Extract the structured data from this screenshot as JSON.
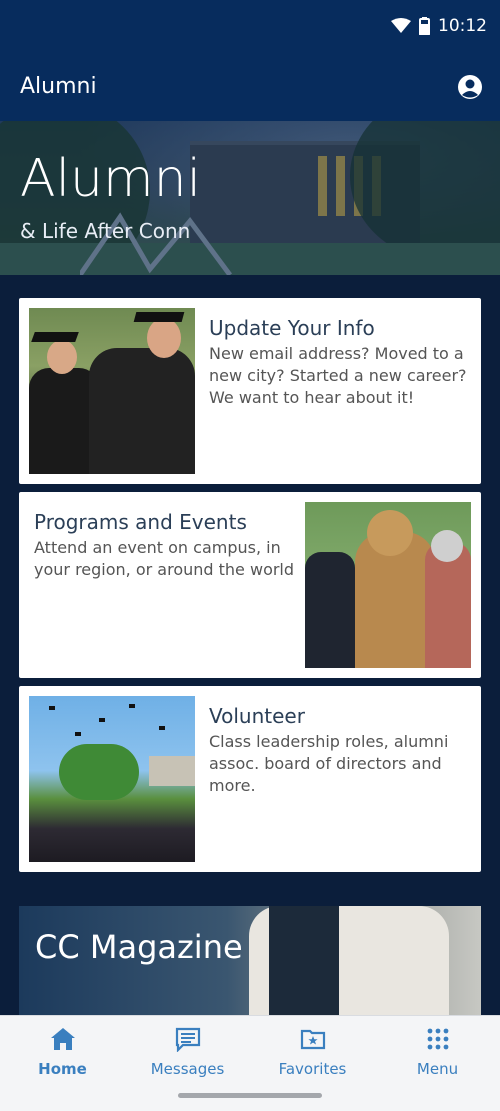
{
  "status_bar": {
    "time": "10:12"
  },
  "app_bar": {
    "title": "Alumni"
  },
  "hero": {
    "title": "Alumni",
    "subtitle": "& Life After Conn"
  },
  "cards": [
    {
      "title": "Update Your Info",
      "description": "New email address? Moved to a new city? Started a new career? We want to hear about it!"
    },
    {
      "title": "Programs and Events",
      "description": "Attend an event on campus, in your region, or around the world"
    },
    {
      "title": "Volunteer",
      "description": "Class leadership roles, alumni assoc. board of directors and more."
    }
  ],
  "magazine": {
    "title": "CC Magazine"
  },
  "bottom_nav": {
    "items": [
      {
        "label": "Home",
        "icon": "home-icon"
      },
      {
        "label": "Messages",
        "icon": "messages-icon"
      },
      {
        "label": "Favorites",
        "icon": "favorites-folder-icon"
      },
      {
        "label": "Menu",
        "icon": "grid-menu-icon"
      }
    ]
  },
  "colors": {
    "header": "#072c5d",
    "background": "#0b1e3b",
    "accent": "#3a7fbf"
  }
}
